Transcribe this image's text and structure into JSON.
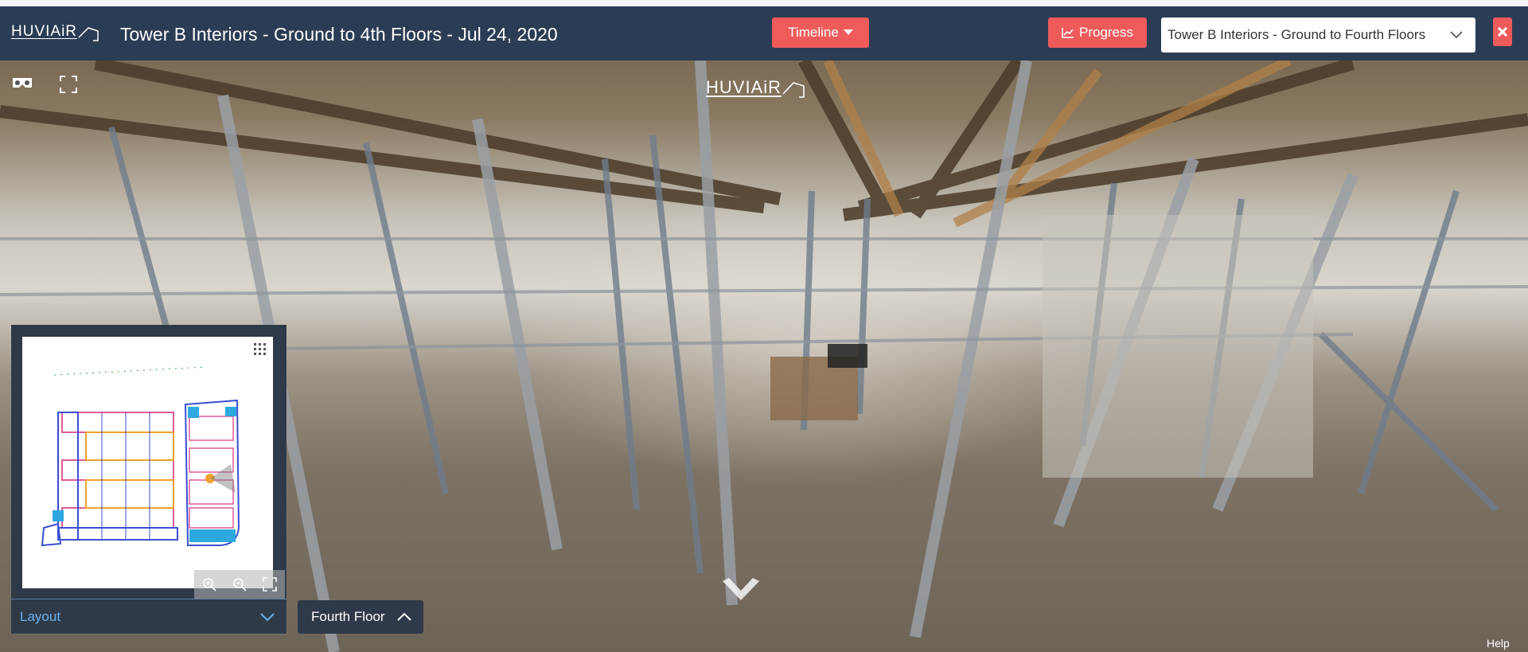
{
  "app": {
    "logo_text": "HUVIAiR",
    "title": "Tower B Interiors - Ground to 4th Floors - Jul 24, 2020"
  },
  "toolbar": {
    "timeline_label": "Timeline",
    "progress_label": "Progress",
    "project_selected": "Tower B Interiors - Ground to Fourth Floors",
    "close_icon": "close-icon"
  },
  "viewer": {
    "watermark": "HUVIAiR",
    "vr_icon": "vr-headset-icon",
    "fullscreen_icon": "fullscreen-icon",
    "nav_icon": "navigation-arrow-icon",
    "help_label": "Help"
  },
  "minimap": {
    "layout_label": "Layout",
    "zoom_in_icon": "zoom-in-icon",
    "zoom_out_icon": "zoom-out-icon",
    "expand_icon": "expand-icon"
  },
  "floor": {
    "current": "Fourth Floor"
  },
  "colors": {
    "topbar": "#2b3d54",
    "accent_button": "#ef5b5b",
    "layout_label": "#6fb0ea",
    "panel": "#2e3a48"
  }
}
